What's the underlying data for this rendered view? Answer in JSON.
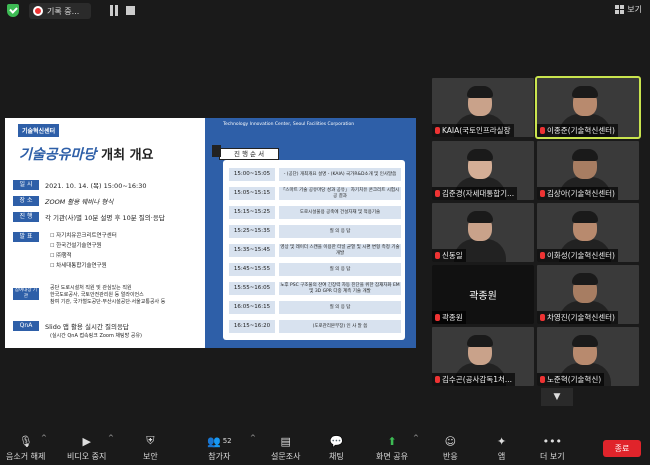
{
  "topbar": {
    "recording_label": "기록 중...",
    "view_label": "보기"
  },
  "slide": {
    "badge": "기술혁신센터",
    "title_em": "기술공유마당",
    "title_rest": "개최 개요",
    "org_en": "Technology Innovation Center, Seoul Facilities Corporation",
    "rows": [
      {
        "label": "일  시",
        "text": "2021. 10. 14. (목) 15:00~16:30"
      },
      {
        "label": "장  소",
        "text": "ZOOM 활용 웨비나 형식"
      },
      {
        "label": "진  행",
        "text": "각 기관(사)별 10분 설명 후 10분 질의·응답"
      }
    ],
    "presenter_label": "발  표",
    "presenters": [
      "자기치유콘크리트연구센터",
      "한국건설기술연구원",
      "㈜행적",
      "차세대통합기술연구원"
    ],
    "attendee_label": "참여대상 기관",
    "attendees": [
      "공단 도로시설처 직원 및 관심있는 직원",
      "한국도로공사, 국토안전관리원 등 얼라이언스",
      "참여 기관, 국가철도공단·부산시설공단·서울교통공사 등"
    ],
    "qna_label": "QnA",
    "qna_text": "Slido 앱 활용 실시간 질의응답",
    "qna_note": "(실시간 QnA 접속링크 Zoom 채팅방 공유)",
    "program_title": "진 행 순 서",
    "program": [
      {
        "time": "15:00~15:05",
        "desc": "- (공단) 개최개요 설명 - (KAIA) 국가R&D소개 및 인사말씀"
      },
      {
        "time": "15:05~15:15",
        "desc": "「스마트 기술 공유마당 성과 공유」 자기치유 콘크리트 시험시공 결과"
      },
      {
        "time": "15:15~15:25",
        "desc": "도로시설물용 공축에 건설자재 및 적용기술"
      },
      {
        "time": "15:25~15:35",
        "desc": "질 의 응 답"
      },
      {
        "time": "15:35~15:45",
        "desc": "영상 및 레이더 스캔을 이용한 터널 균열 및 시편 변형 측정 기술 개발"
      },
      {
        "time": "15:45~15:55",
        "desc": "질 의 응 답"
      },
      {
        "time": "15:55~16:05",
        "desc": "노후 PSC 구조물의 잔여 긴장력 자동 진단을 위한 잠재자화 EM 및 3D GPR 다중 계측 기술 개발"
      },
      {
        "time": "16:05~16:15",
        "desc": "질 의 응 답"
      },
      {
        "time": "16:15~16:20",
        "desc": "(도로관리본부장) 인 사 말 씀"
      }
    ]
  },
  "participants": [
    {
      "name": "KAIA(국토인프라실장",
      "muted": true
    },
    {
      "name": "이종준(기술혁신센터)",
      "muted": true,
      "active": true
    },
    {
      "name": "김준경(자세대통합기...",
      "muted": true
    },
    {
      "name": "김상아(기술혁신센터)",
      "muted": true
    },
    {
      "name": "신동일",
      "muted": true
    },
    {
      "name": "이화성(기술혁신센터)",
      "muted": true
    },
    {
      "name": "곽종원",
      "muted": true,
      "big_name": "곽종원"
    },
    {
      "name": "차영진(기술혁신센터)",
      "muted": true
    },
    {
      "name": "김수곤(공사감독1처...",
      "muted": true
    },
    {
      "name": "노준혁(기술혁신)",
      "muted": true
    }
  ],
  "toolbar": {
    "items": [
      "음소거 해제",
      "비디오 중지",
      "보안",
      "참가자",
      "설문조사",
      "채팅",
      "화면 공유",
      "반응",
      "앱",
      "더 보기"
    ],
    "participant_count": "52",
    "end_label": "종료"
  }
}
